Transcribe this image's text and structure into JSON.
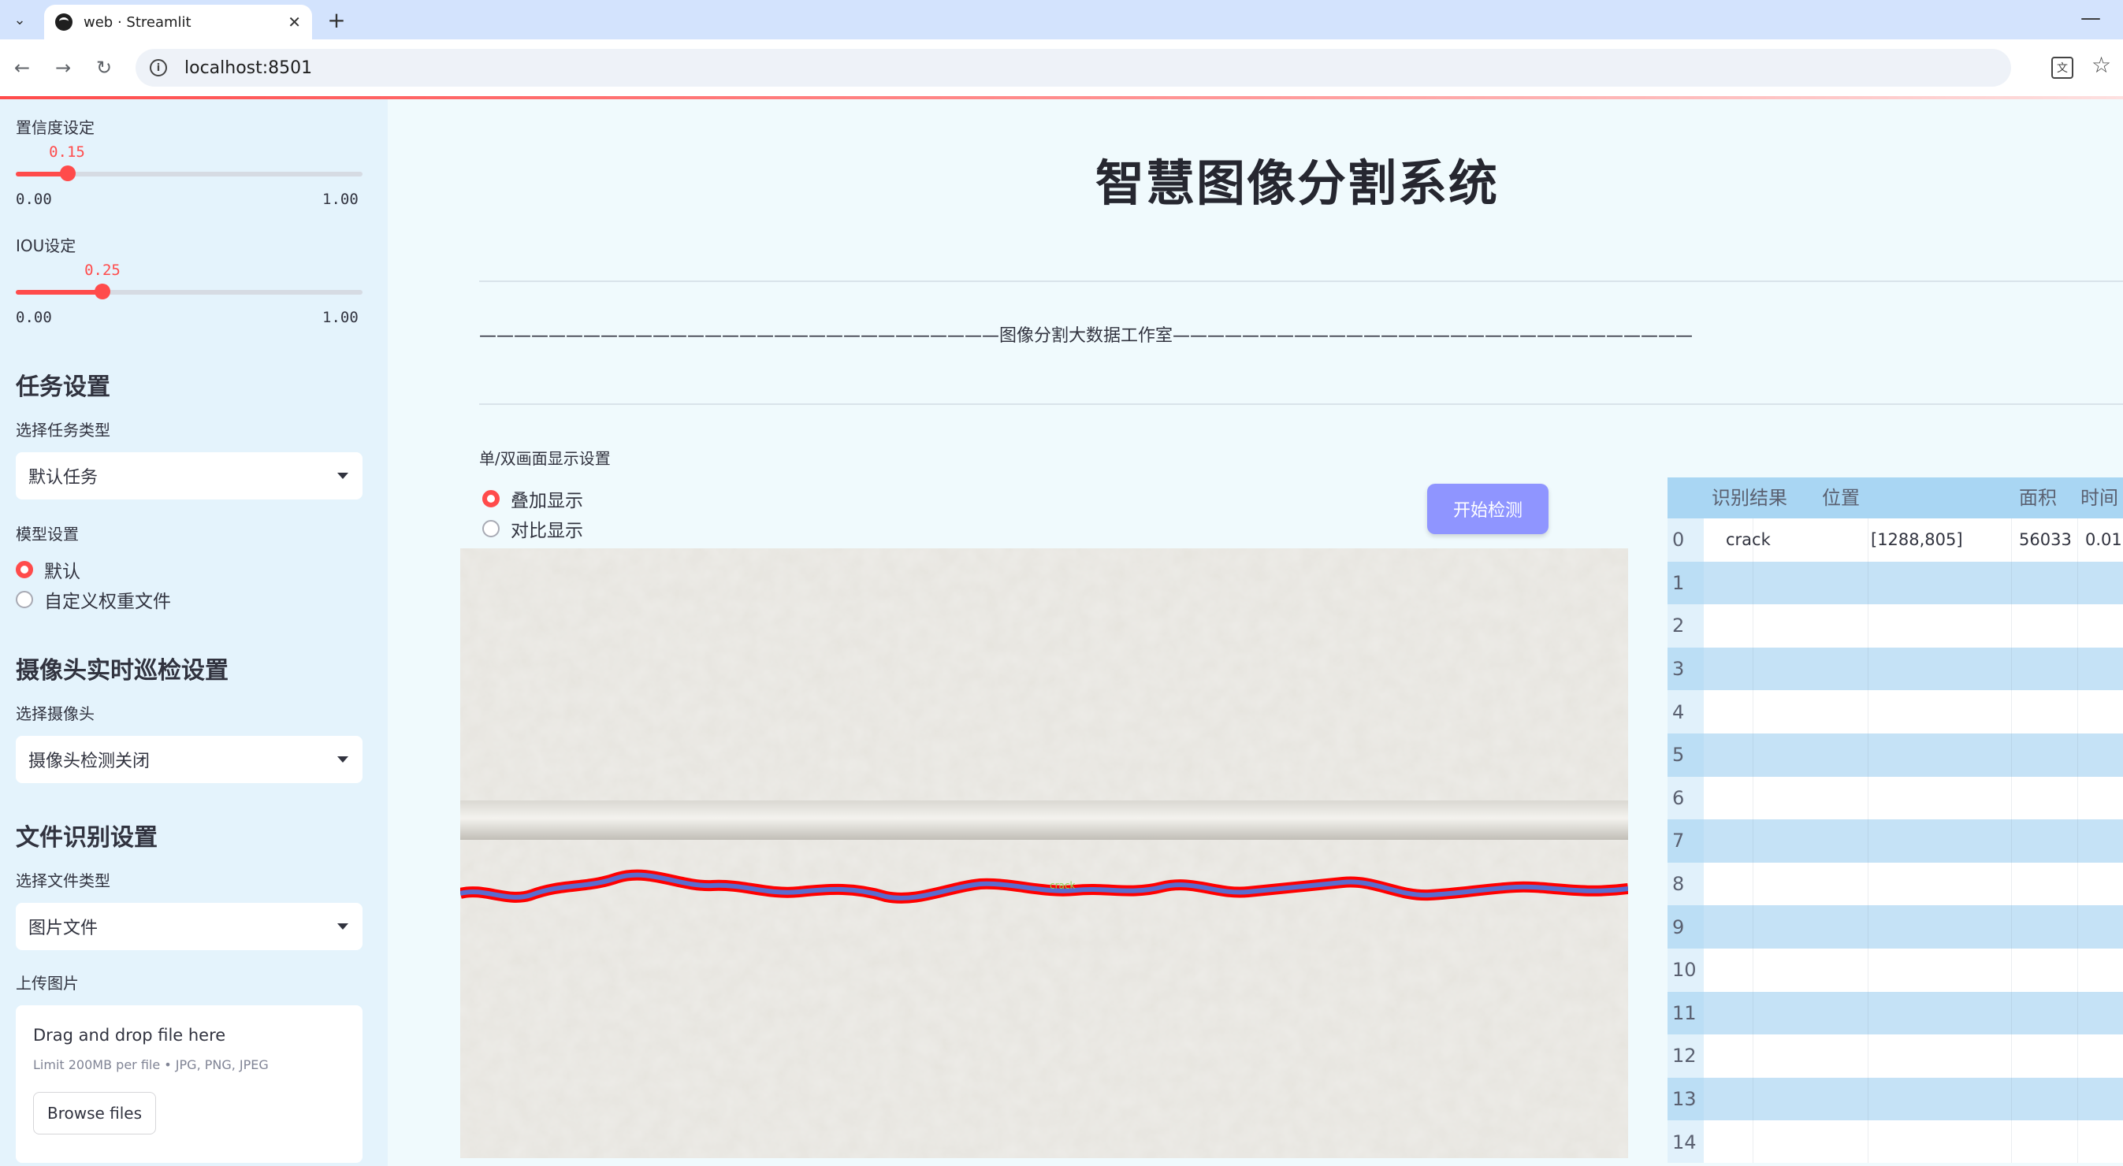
{
  "browser": {
    "tab_title": "web · Streamlit",
    "url": "localhost:8501"
  },
  "sidebar": {
    "confidence": {
      "label": "置信度设定",
      "value": "0.15",
      "value_num": 0.15,
      "min": "0.00",
      "max": "1.00"
    },
    "iou": {
      "label": "IOU设定",
      "value": "0.25",
      "value_num": 0.25,
      "min": "0.00",
      "max": "1.00"
    },
    "task_header": "任务设置",
    "task_type_label": "选择任务类型",
    "task_type_value": "默认任务",
    "model_label": "模型设置",
    "model_options": [
      "默认",
      "自定义权重文件"
    ],
    "model_selected": "默认",
    "camera_header": "摄像头实时巡检设置",
    "camera_label": "选择摄像头",
    "camera_value": "摄像头检测关闭",
    "file_header": "文件识别设置",
    "file_type_label": "选择文件类型",
    "file_type_value": "图片文件",
    "upload_label": "上传图片",
    "upload": {
      "title": "Drag and drop file here",
      "limit": "Limit 200MB per file • JPG, PNG, JPEG",
      "browse": "Browse files"
    }
  },
  "main": {
    "title": "智慧图像分割系统",
    "subtitle_line": "——————————————————————————————图像分割大数据工作室——————————————————————————————",
    "display_label": "单/双画面显示设置",
    "display_options": [
      "叠加显示",
      "对比显示"
    ],
    "display_selected": "叠加显示",
    "start_button": "开始检测",
    "detection_label": "crack"
  },
  "table": {
    "columns": [
      "识别结果",
      "位置",
      "面积",
      "时间"
    ],
    "rows": [
      {
        "idx": "0",
        "result": "crack",
        "position": "[1288,805]",
        "area": "56033",
        "time": "0.01"
      },
      {
        "idx": "1"
      },
      {
        "idx": "2"
      },
      {
        "idx": "3"
      },
      {
        "idx": "4"
      },
      {
        "idx": "5"
      },
      {
        "idx": "6"
      },
      {
        "idx": "7"
      },
      {
        "idx": "8"
      },
      {
        "idx": "9"
      },
      {
        "idx": "10"
      },
      {
        "idx": "11"
      },
      {
        "idx": "12"
      },
      {
        "idx": "13"
      },
      {
        "idx": "14"
      }
    ]
  },
  "colors": {
    "accent": "#ff4b4b",
    "start_button": "#8f95ff",
    "sidebar_bg": "#e4f3fc",
    "table_header": "#a9d6f3",
    "mask_outline": "#ff0000",
    "mask_fill": "#5a6ccf"
  },
  "icons": [
    "chevron-down-icon",
    "close-icon",
    "plus-icon",
    "back-icon",
    "forward-icon",
    "reload-icon",
    "info-icon",
    "translate-icon",
    "star-icon",
    "minimize-icon"
  ]
}
